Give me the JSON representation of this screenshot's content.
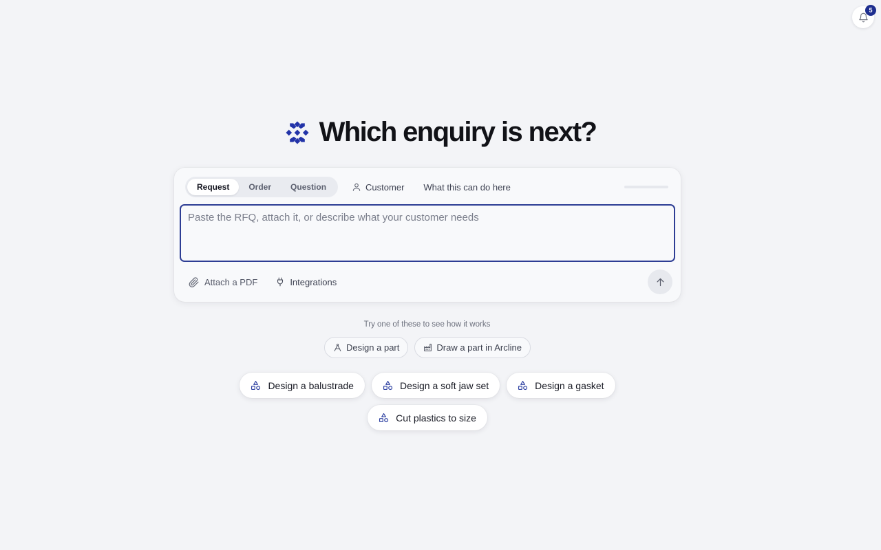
{
  "notifications": {
    "icon": "bell-icon",
    "count": "5",
    "badge_color": "#1e2e8f"
  },
  "hero": {
    "logo": "brand-logo-icon",
    "title": "Which enquiry is next?",
    "brand_color": "#2233a8"
  },
  "composer": {
    "mode_tabs": [
      {
        "label": "Request",
        "active": true
      },
      {
        "label": "Order",
        "active": false
      },
      {
        "label": "Question",
        "active": false
      }
    ],
    "customer_label": "Customer",
    "help_label": "What this can do here",
    "input_placeholder": "Paste the RFQ, attach it, or describe what your customer needs",
    "input_border_color": "#2d3d94",
    "attach_label": "Attach a PDF",
    "integrations_label": "Integrations",
    "send_icon": "arrow-up-icon"
  },
  "suggestions": {
    "caption": "Try one of these to see how it works",
    "small": [
      {
        "label": "Design a part",
        "icon": "compass-icon"
      },
      {
        "label": "Draw a part in Arcline",
        "icon": "factory-icon"
      }
    ],
    "large_row1": [
      {
        "label": "Design a balustrade",
        "icon": "shapes-icon"
      },
      {
        "label": "Design a soft jaw set",
        "icon": "shapes-icon"
      },
      {
        "label": "Design a gasket",
        "icon": "shapes-icon"
      }
    ],
    "large_row2": [
      {
        "label": "Cut plastics to size",
        "icon": "shapes-icon"
      }
    ]
  }
}
